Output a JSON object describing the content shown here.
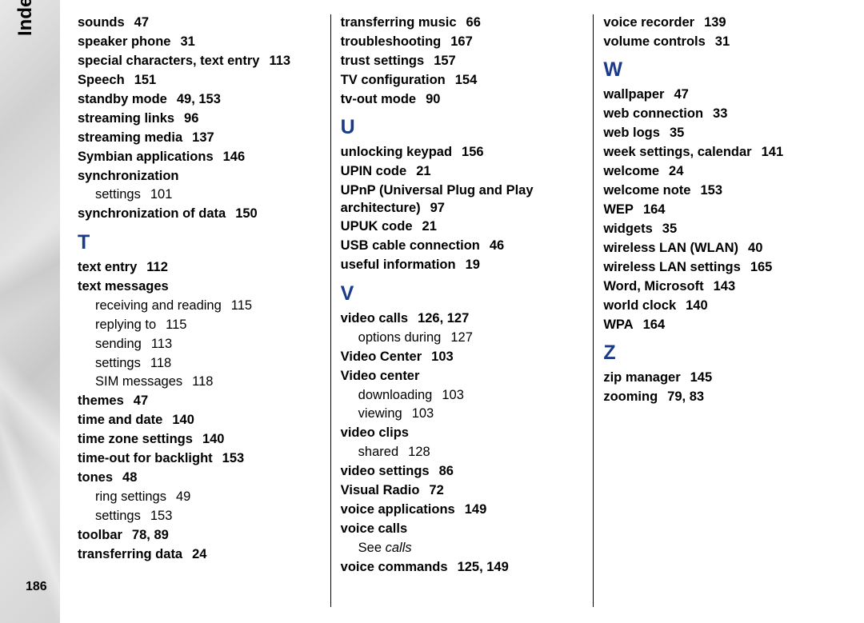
{
  "sideLabel": "Index",
  "pageNumber": "186",
  "columns": [
    [
      {
        "type": "entry",
        "term": "sounds",
        "pages": "47"
      },
      {
        "type": "entry",
        "term": "speaker phone",
        "pages": "31"
      },
      {
        "type": "entry",
        "term": "special characters, text entry",
        "pages": "113"
      },
      {
        "type": "entry",
        "term": "Speech",
        "pages": "151"
      },
      {
        "type": "entry",
        "term": "standby mode",
        "pages": "49, 153"
      },
      {
        "type": "entry",
        "term": "streaming links",
        "pages": "96"
      },
      {
        "type": "entry",
        "term": "streaming media",
        "pages": "137"
      },
      {
        "type": "entry",
        "term": "Symbian applications",
        "pages": "146"
      },
      {
        "type": "entry",
        "term": "synchronization",
        "pages": ""
      },
      {
        "type": "sub",
        "term": "settings",
        "pages": "101"
      },
      {
        "type": "entry",
        "term": "synchronization of data",
        "pages": "150"
      },
      {
        "type": "letter",
        "text": "T"
      },
      {
        "type": "entry",
        "term": "text entry",
        "pages": "112"
      },
      {
        "type": "entry",
        "term": "text messages",
        "pages": ""
      },
      {
        "type": "sub",
        "term": "receiving and reading",
        "pages": "115"
      },
      {
        "type": "sub",
        "term": "replying to",
        "pages": "115"
      },
      {
        "type": "sub",
        "term": "sending",
        "pages": "113"
      },
      {
        "type": "sub",
        "term": "settings",
        "pages": "118"
      },
      {
        "type": "sub",
        "term": "SIM messages",
        "pages": "118"
      },
      {
        "type": "entry",
        "term": "themes",
        "pages": "47"
      },
      {
        "type": "entry",
        "term": "time and date",
        "pages": "140"
      },
      {
        "type": "entry",
        "term": "time zone settings",
        "pages": "140"
      },
      {
        "type": "entry",
        "term": "time-out for backlight",
        "pages": "153"
      },
      {
        "type": "entry",
        "term": "tones",
        "pages": "48"
      },
      {
        "type": "sub",
        "term": "ring settings",
        "pages": "49"
      },
      {
        "type": "sub",
        "term": "settings",
        "pages": "153"
      },
      {
        "type": "entry",
        "term": "toolbar",
        "pages": "78, 89"
      },
      {
        "type": "entry",
        "term": "transferring data",
        "pages": "24"
      }
    ],
    [
      {
        "type": "entry",
        "term": "transferring music",
        "pages": "66"
      },
      {
        "type": "entry",
        "term": "troubleshooting",
        "pages": "167"
      },
      {
        "type": "entry",
        "term": "trust settings",
        "pages": "157"
      },
      {
        "type": "entry",
        "term": "TV configuration",
        "pages": "154"
      },
      {
        "type": "entry",
        "term": "tv-out mode",
        "pages": "90"
      },
      {
        "type": "letter",
        "text": "U"
      },
      {
        "type": "entry",
        "term": "unlocking keypad",
        "pages": "156"
      },
      {
        "type": "entry",
        "term": "UPIN code",
        "pages": "21"
      },
      {
        "type": "entry",
        "term": "UPnP (Universal Plug and Play architecture)",
        "pages": "97"
      },
      {
        "type": "entry",
        "term": "UPUK code",
        "pages": "21"
      },
      {
        "type": "entry",
        "term": "USB cable connection",
        "pages": "46"
      },
      {
        "type": "entry",
        "term": "useful information",
        "pages": "19"
      },
      {
        "type": "letter",
        "text": "V"
      },
      {
        "type": "entry",
        "term": "video calls",
        "pages": "126, 127"
      },
      {
        "type": "sub",
        "term": "options during",
        "pages": "127"
      },
      {
        "type": "entry",
        "term": "Video Center",
        "pages": "103"
      },
      {
        "type": "entry",
        "term": "Video center",
        "pages": ""
      },
      {
        "type": "sub",
        "term": "downloading",
        "pages": "103"
      },
      {
        "type": "sub",
        "term": "viewing",
        "pages": "103"
      },
      {
        "type": "entry",
        "term": "video clips",
        "pages": ""
      },
      {
        "type": "sub",
        "term": "shared",
        "pages": "128"
      },
      {
        "type": "entry",
        "term": "video settings",
        "pages": "86"
      },
      {
        "type": "entry",
        "term": "Visual Radio",
        "pages": "72"
      },
      {
        "type": "entry",
        "term": "voice applications",
        "pages": "149"
      },
      {
        "type": "entry",
        "term": "voice calls",
        "pages": ""
      },
      {
        "type": "see",
        "prefix": "See ",
        "ref": "calls"
      },
      {
        "type": "entry",
        "term": "voice commands",
        "pages": "125, 149"
      }
    ],
    [
      {
        "type": "entry",
        "term": "voice recorder",
        "pages": "139"
      },
      {
        "type": "entry",
        "term": "volume controls",
        "pages": "31"
      },
      {
        "type": "letter",
        "text": "W"
      },
      {
        "type": "entry",
        "term": "wallpaper",
        "pages": "47"
      },
      {
        "type": "entry",
        "term": "web connection",
        "pages": "33"
      },
      {
        "type": "entry",
        "term": "web logs",
        "pages": "35"
      },
      {
        "type": "entry",
        "term": "week settings, calendar",
        "pages": "141"
      },
      {
        "type": "entry",
        "term": "welcome",
        "pages": "24"
      },
      {
        "type": "entry",
        "term": "welcome note",
        "pages": "153"
      },
      {
        "type": "entry",
        "term": "WEP",
        "pages": "164"
      },
      {
        "type": "entry",
        "term": "widgets",
        "pages": "35"
      },
      {
        "type": "entry",
        "term": "wireless LAN (WLAN)",
        "pages": "40"
      },
      {
        "type": "entry",
        "term": "wireless LAN settings",
        "pages": "165"
      },
      {
        "type": "entry",
        "term": "Word, Microsoft",
        "pages": "143"
      },
      {
        "type": "entry",
        "term": "world clock",
        "pages": "140"
      },
      {
        "type": "entry",
        "term": "WPA",
        "pages": "164"
      },
      {
        "type": "letter",
        "text": "Z"
      },
      {
        "type": "entry",
        "term": "zip manager",
        "pages": "145"
      },
      {
        "type": "entry",
        "term": "zooming",
        "pages": "79, 83"
      }
    ]
  ]
}
